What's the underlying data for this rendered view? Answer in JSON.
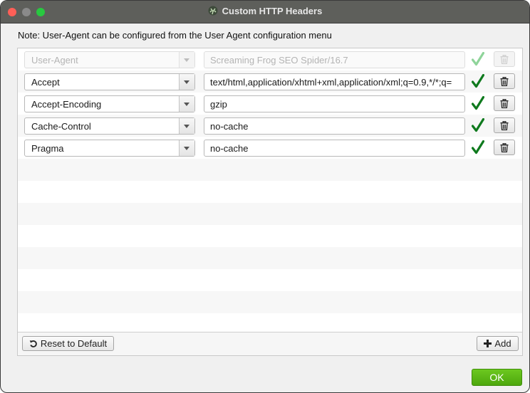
{
  "window": {
    "title": "Custom HTTP Headers",
    "controls": [
      "close",
      "minimize",
      "maximize"
    ]
  },
  "note": "Note: User-Agent can be configured from the User Agent configuration menu",
  "headers": [
    {
      "name": "User-Agent",
      "value": "Screaming Frog SEO Spider/16.7",
      "valid": true,
      "disabled": true
    },
    {
      "name": "Accept",
      "value": "text/html,application/xhtml+xml,application/xml;q=0.9,*/*;q=",
      "valid": true,
      "disabled": false
    },
    {
      "name": "Accept-Encoding",
      "value": "gzip",
      "valid": true,
      "disabled": false
    },
    {
      "name": "Cache-Control",
      "value": "no-cache",
      "valid": true,
      "disabled": false
    },
    {
      "name": "Pragma",
      "value": "no-cache",
      "valid": true,
      "disabled": false
    }
  ],
  "buttons": {
    "reset": "Reset to Default",
    "add": "Add",
    "ok": "OK"
  },
  "colors": {
    "valid_check": "#0f7a1e",
    "valid_check_disabled": "#8fd49a",
    "ok_button": "#5cb815",
    "titlebar": "#5e5f5b"
  },
  "icons": {
    "valid": "checkmark-icon",
    "delete": "trash-icon",
    "reset": "undo-icon",
    "add": "plus-icon",
    "dropdown": "chevron-down-icon"
  }
}
